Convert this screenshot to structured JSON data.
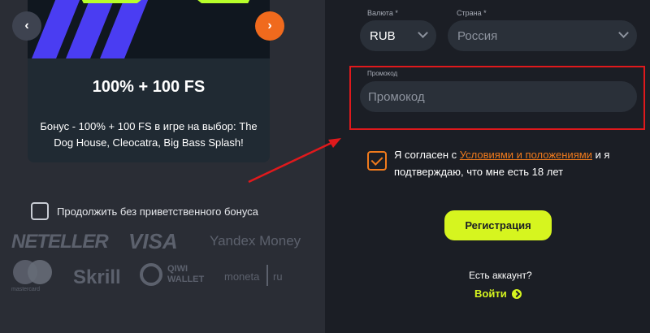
{
  "bonus": {
    "title": "100% + 100 FS",
    "description": "Бонус - 100% + 100 FS в игре на выбор: The Dog House, Cleocatra, Big Bass Splash!"
  },
  "carousel": {
    "prev_icon": "‹",
    "next_icon": "›"
  },
  "skip_bonus": {
    "label": "Продолжить без приветственного бонуса",
    "checked": false
  },
  "payments": {
    "neteller": "NETELLER",
    "visa": "VISA",
    "yandex": "Yandex Money",
    "mastercard": "mastercard",
    "skrill": "Skrill",
    "qiwi_line1": "QIWI",
    "qiwi_line2": "WALLET",
    "moneta": "moneta",
    "moneta_ru": "ru"
  },
  "form": {
    "currency_label": "Валюта *",
    "currency_value": "RUB",
    "country_label": "Страна *",
    "country_value": "Россия",
    "promo_label": "Промокод",
    "promo_placeholder": "Промокод",
    "agree_prefix": "Я согласен с ",
    "agree_link": "Условиями и положениями",
    "agree_suffix": " и я подтверждаю, что мне есть 18 лет",
    "agree_checked": true,
    "register_label": "Регистрация",
    "account_question": "Есть аккаунт?",
    "login_label": "Войти"
  },
  "colors": {
    "accent_lime": "#d6f51f",
    "accent_orange": "#f07a1c",
    "highlight_red": "#e0191c"
  }
}
